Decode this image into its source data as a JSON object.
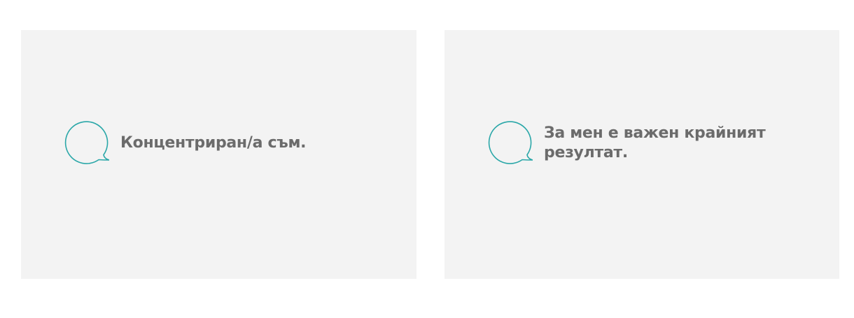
{
  "cards": [
    {
      "text": "Концентриран/а съм.",
      "icon": "speech-bubble-icon"
    },
    {
      "text": "За мен е важен крайният резултат.",
      "icon": "speech-bubble-icon"
    }
  ],
  "colors": {
    "card_background": "#f3f3f3",
    "icon_stroke": "#2aa7a8",
    "text": "#6b6b6b"
  }
}
